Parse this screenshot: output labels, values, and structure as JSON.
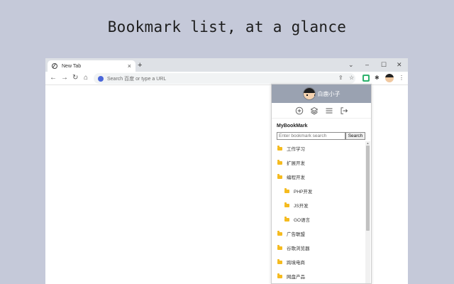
{
  "headline": "Bookmark list, at a glance",
  "browser": {
    "tab_title": "New Tab",
    "tab_close": "×",
    "new_tab": "+",
    "window_controls": [
      "⌄",
      "–",
      "☐",
      "✕"
    ],
    "omnibox_placeholder": "Search 百度 or type a URL",
    "nav": {
      "back": "←",
      "forward": "→",
      "reload": "↻",
      "home": "⌂"
    },
    "toolbar_icons": {
      "share": "⇪",
      "star": "☆",
      "extensions": "✱",
      "menu": "⋮"
    }
  },
  "popup": {
    "username": "白鹿小子",
    "title": "MyBookMark",
    "search_placeholder": "Enter bookmark search",
    "search_button": "Search",
    "actions": [
      "add-icon",
      "layers-icon",
      "list-icon",
      "logout-icon"
    ],
    "bookmarks": [
      {
        "label": "工作学习",
        "level": 0
      },
      {
        "label": "扩展开发",
        "level": 0
      },
      {
        "label": "编程开发",
        "level": 0
      },
      {
        "label": "PHP开发",
        "level": 1
      },
      {
        "label": "JS开发",
        "level": 1
      },
      {
        "label": "GO语言",
        "level": 1
      },
      {
        "label": "广告联盟",
        "level": 0
      },
      {
        "label": "谷歌浏览器",
        "level": 0
      },
      {
        "label": "跨境电商",
        "level": 0
      },
      {
        "label": "网盘产品",
        "level": 0
      }
    ],
    "colors": {
      "header": "#9aa2b1",
      "folder": "#f5bb1f"
    }
  }
}
